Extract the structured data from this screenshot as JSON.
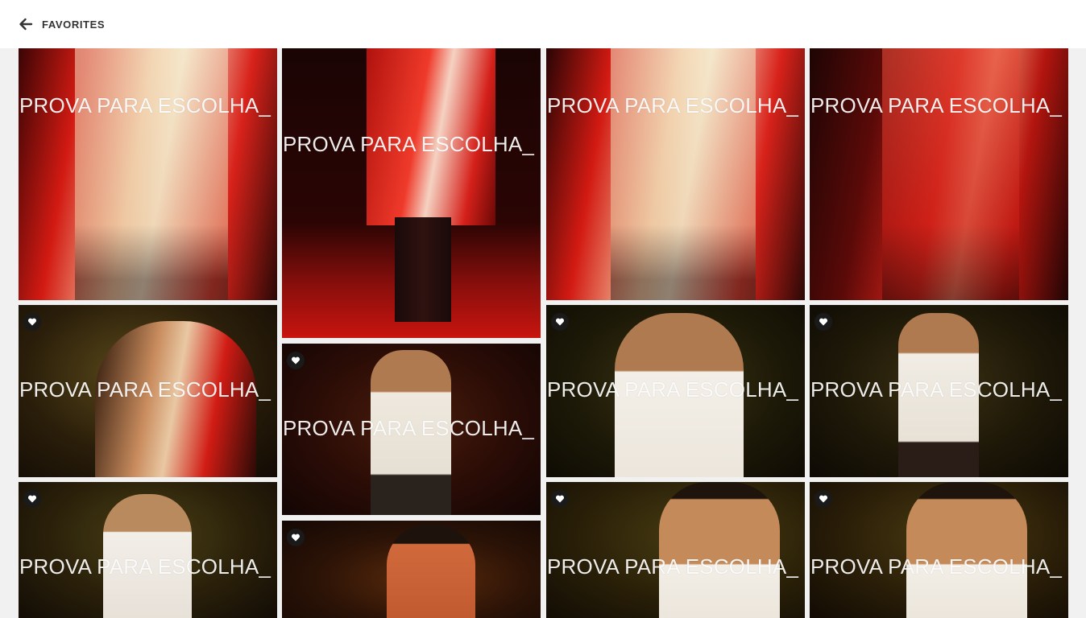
{
  "header": {
    "title": "FAVORITES",
    "back_icon": "arrow-left-icon"
  },
  "watermark": "PROVA PARA ESCOLHA_",
  "favorite_icon": "heart-icon",
  "colors": {
    "header_bg": "#ffffff",
    "page_bg": "#f2f1f1",
    "fav_badge": "#1a1a1a"
  },
  "photos": [
    {
      "id": "c1r1",
      "favorite": false
    },
    {
      "id": "c2r1",
      "favorite": false
    },
    {
      "id": "c3r1",
      "favorite": false
    },
    {
      "id": "c4r1",
      "favorite": false
    },
    {
      "id": "c1r2",
      "favorite": true
    },
    {
      "id": "c2r2",
      "favorite": true
    },
    {
      "id": "c3r2",
      "favorite": true
    },
    {
      "id": "c4r2",
      "favorite": true
    },
    {
      "id": "c1r3",
      "favorite": true
    },
    {
      "id": "c2r3",
      "favorite": true
    },
    {
      "id": "c3r3",
      "favorite": true
    },
    {
      "id": "c4r3",
      "favorite": true
    }
  ]
}
